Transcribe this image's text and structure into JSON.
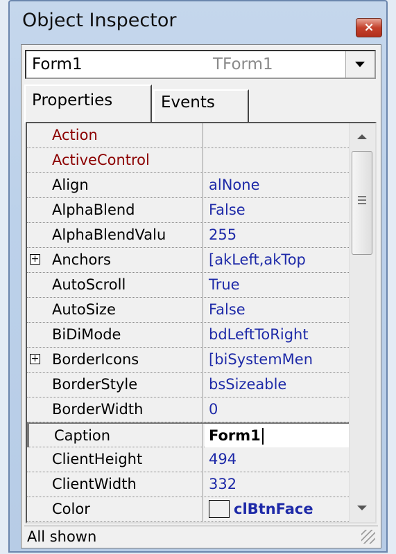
{
  "window": {
    "title": "Object Inspector",
    "close_label": "×"
  },
  "selector": {
    "name": "Form1",
    "type": "TForm1"
  },
  "tabs": [
    {
      "label": "Properties"
    },
    {
      "label": "Events"
    }
  ],
  "properties": [
    {
      "name": "Action",
      "value": "",
      "kind": "reference"
    },
    {
      "name": "ActiveControl",
      "value": "",
      "kind": "reference"
    },
    {
      "name": "Align",
      "value": "alNone"
    },
    {
      "name": "AlphaBlend",
      "value": "False"
    },
    {
      "name": "AlphaBlendValu",
      "value": "255"
    },
    {
      "name": "Anchors",
      "value": "[akLeft,akTop",
      "expandable": true
    },
    {
      "name": "AutoScroll",
      "value": "True"
    },
    {
      "name": "AutoSize",
      "value": "False"
    },
    {
      "name": "BiDiMode",
      "value": "bdLeftToRight"
    },
    {
      "name": "BorderIcons",
      "value": "[biSystemMen",
      "expandable": true
    },
    {
      "name": "BorderStyle",
      "value": "bsSizeable"
    },
    {
      "name": "BorderWidth",
      "value": "0"
    },
    {
      "name": "Caption",
      "value": "Form1",
      "selected": true
    },
    {
      "name": "ClientHeight",
      "value": "494"
    },
    {
      "name": "ClientWidth",
      "value": "332"
    },
    {
      "name": "Color",
      "value": "clBtnFace",
      "swatch": "#f0f0f0"
    }
  ],
  "status": {
    "text": "All shown"
  },
  "colors": {
    "value_text": "#1e2aa8",
    "reference_text": "#8b0000",
    "title_bar": "#bcd1ea"
  }
}
